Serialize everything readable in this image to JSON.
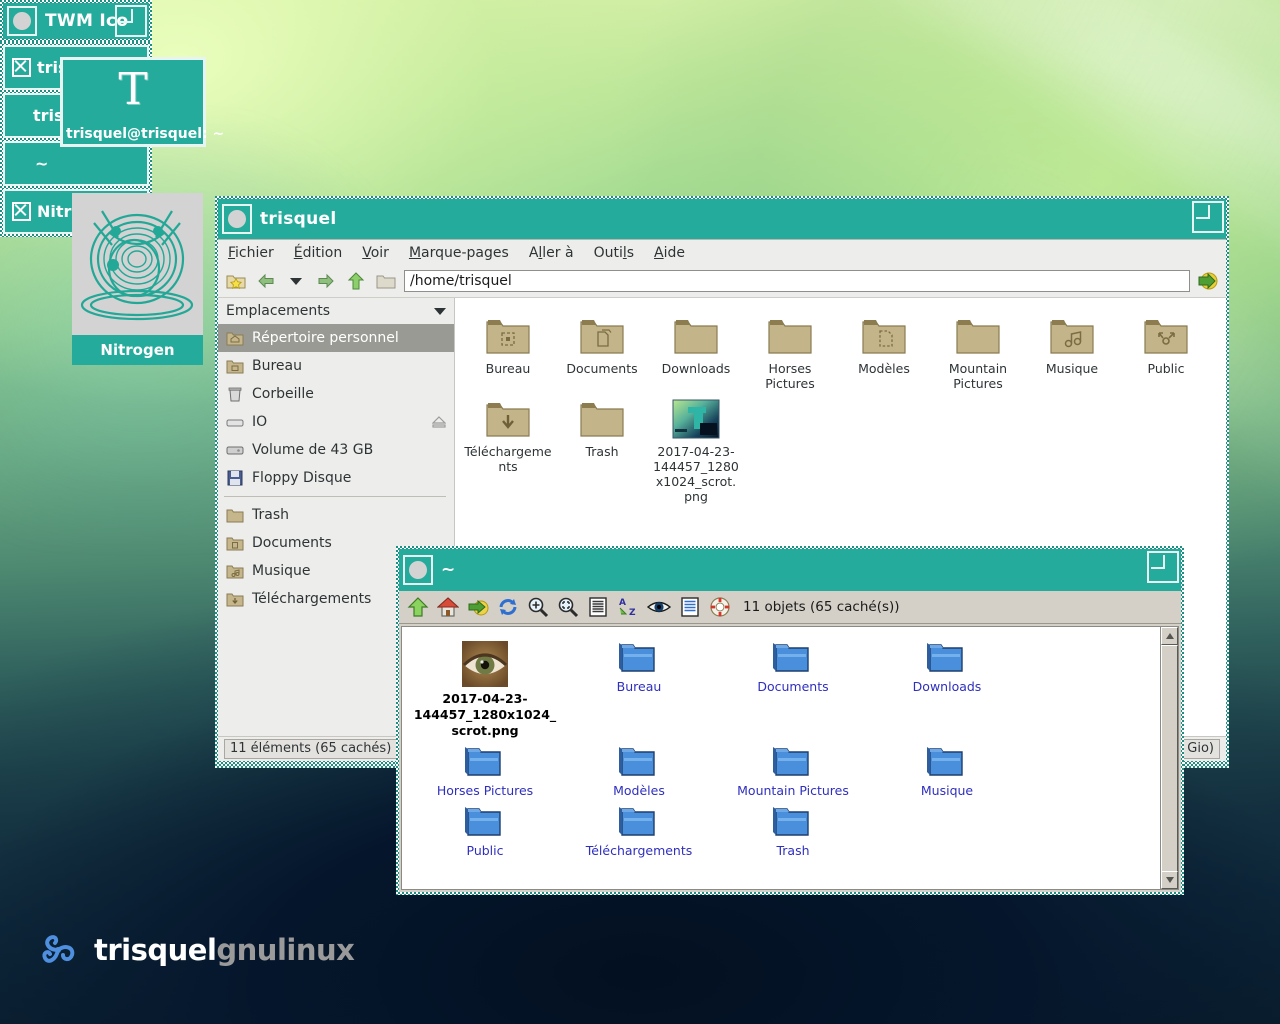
{
  "desktop": {
    "brand": {
      "name_primary": "trisquel",
      "name_secondary": "gnulinux"
    }
  },
  "twm": {
    "icon_manager": {
      "title": "TWM Ico",
      "entries": [
        {
          "label": "trisqu",
          "has_x": true
        },
        {
          "label": "trisqu",
          "has_x": false
        },
        {
          "label": "~",
          "has_x": false
        },
        {
          "label": "Nitroge",
          "has_x": true
        }
      ]
    },
    "xterm_icon": {
      "glyph": "T",
      "label": "trisquel@trisquel: ~"
    },
    "nitrogen_icon": {
      "label": "Nitrogen"
    }
  },
  "file_manager": {
    "title": "trisquel",
    "menu": [
      {
        "label": "Fichier",
        "mnemonic": "F"
      },
      {
        "label": "Édition",
        "mnemonic": "É"
      },
      {
        "label": "Voir",
        "mnemonic": "V"
      },
      {
        "label": "Marque-pages",
        "mnemonic": "M"
      },
      {
        "label": "Aller à",
        "mnemonic": "A"
      },
      {
        "label": "Outils",
        "mnemonic": "O"
      },
      {
        "label": "Aide",
        "mnemonic": "A"
      }
    ],
    "toolbar": {
      "bookmark_icon": "star-folder-icon",
      "back_icon": "back-arrow-icon",
      "history_icon": "chevron-down-icon",
      "forward_icon": "forward-arrow-icon",
      "up_icon": "up-arrow-icon",
      "open_folder_icon": "folder-icon",
      "go_icon": "go-arrow-icon"
    },
    "path_value": "/home/trisquel",
    "sidebar": {
      "header": "Emplacements",
      "groups": [
        [
          {
            "label": "Répertoire personnel",
            "icon": "home-folder-icon",
            "selected": true
          },
          {
            "label": "Bureau",
            "icon": "desktop-folder-icon",
            "selected": false
          },
          {
            "label": "Corbeille",
            "icon": "trash-icon",
            "selected": false
          },
          {
            "label": "IO",
            "icon": "drive-icon",
            "selected": false,
            "eject": true
          },
          {
            "label": "Volume de 43 GB",
            "icon": "harddisk-icon",
            "selected": false
          },
          {
            "label": "Floppy Disque",
            "icon": "floppy-icon",
            "selected": false
          }
        ],
        [
          {
            "label": "Trash",
            "icon": "folder-icon",
            "selected": false
          },
          {
            "label": "Documents",
            "icon": "documents-folder-icon",
            "selected": false
          },
          {
            "label": "Musique",
            "icon": "music-folder-icon",
            "selected": false
          },
          {
            "label": "Téléchargements",
            "icon": "downloads-folder-icon",
            "selected": false
          }
        ]
      ]
    },
    "files": [
      {
        "name": "Bureau",
        "icon": "desktop-folder-icon",
        "type": "folder"
      },
      {
        "name": "Documents",
        "icon": "documents-folder-icon",
        "type": "folder"
      },
      {
        "name": "Downloads",
        "icon": "folder-icon",
        "type": "folder"
      },
      {
        "name": "Horses Pictures",
        "icon": "folder-icon",
        "type": "folder"
      },
      {
        "name": "Modèles",
        "icon": "templates-folder-icon",
        "type": "folder"
      },
      {
        "name": "Mountain Pictures",
        "icon": "folder-icon",
        "type": "folder"
      },
      {
        "name": "Musique",
        "icon": "music-folder-icon",
        "type": "folder"
      },
      {
        "name": "Public",
        "icon": "public-folder-icon",
        "type": "folder"
      },
      {
        "name": "Téléchargements",
        "icon": "downloads-folder-icon",
        "type": "folder"
      },
      {
        "name": "Trash",
        "icon": "folder-icon",
        "type": "folder"
      },
      {
        "name": "2017-04-23-144457_1280x1024_scrot.png",
        "icon": "image-thumbnail",
        "type": "image"
      }
    ],
    "status_left": "11 éléments (65 cachés)",
    "status_right_partial": "Gio)"
  },
  "file_manager_2": {
    "title": "~",
    "toolbar_icons": [
      "up-arrow-icon",
      "home-icon",
      "go-icon",
      "refresh-icon",
      "zoom-in-icon",
      "zoom-fit-icon",
      "list-view-icon",
      "sort-az-icon",
      "show-hidden-eye-icon",
      "detail-view-icon",
      "help-icon"
    ],
    "status": "11 objets (65 caché(s))",
    "files": [
      {
        "name": "2017-04-23-144457_1280x1024_scrot.png",
        "icon": "image-thumbnail",
        "type": "image",
        "selected": true
      },
      {
        "name": "Bureau",
        "icon": "folder-blue-icon",
        "type": "folder",
        "selected": false
      },
      {
        "name": "Documents",
        "icon": "folder-blue-icon",
        "type": "folder",
        "selected": false
      },
      {
        "name": "Downloads",
        "icon": "folder-blue-icon",
        "type": "folder",
        "selected": false
      },
      {
        "name": "Horses Pictures",
        "icon": "folder-blue-icon",
        "type": "folder",
        "selected": false
      },
      {
        "name": "Modèles",
        "icon": "folder-blue-icon",
        "type": "folder",
        "selected": false
      },
      {
        "name": "Mountain Pictures",
        "icon": "folder-blue-icon",
        "type": "folder",
        "selected": false
      },
      {
        "name": "Musique",
        "icon": "folder-blue-icon",
        "type": "folder",
        "selected": false
      },
      {
        "name": "Public",
        "icon": "folder-blue-icon",
        "type": "folder",
        "selected": false
      },
      {
        "name": "Téléchargements",
        "icon": "folder-blue-icon",
        "type": "folder",
        "selected": false
      },
      {
        "name": "Trash",
        "icon": "folder-blue-icon",
        "type": "folder",
        "selected": false
      }
    ]
  },
  "colors": {
    "titlebar_teal": "#24ab9b",
    "gtk_bg": "#ededeb",
    "win95_bg": "#d4d0c8",
    "folder_tan": "#c6b68b",
    "folder_blue": "#3f7fd0",
    "link_blue": "#2f2fbf"
  }
}
